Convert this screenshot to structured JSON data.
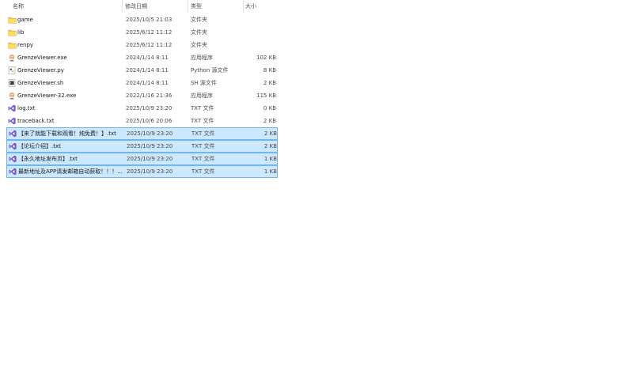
{
  "columns": {
    "name": "名称",
    "date": "修改日期",
    "type": "类型",
    "size": "大小"
  },
  "sort_indicator": "^",
  "files": [
    {
      "name": "game",
      "date": "2025/10/5 21:03",
      "type": "文件夹",
      "size": "",
      "icon": "folder-icon",
      "selected": false
    },
    {
      "name": "lib",
      "date": "2025/6/12 11:12",
      "type": "文件夹",
      "size": "",
      "icon": "folder-icon",
      "selected": false
    },
    {
      "name": "renpy",
      "date": "2025/6/12 11:12",
      "type": "文件夹",
      "size": "",
      "icon": "folder-icon",
      "selected": false
    },
    {
      "name": "GrenzeViewer.exe",
      "date": "2024/1/14 8:11",
      "type": "应用程序",
      "size": "102 KB",
      "icon": "app-icon",
      "selected": false
    },
    {
      "name": "GrenzeViewer.py",
      "date": "2024/1/14 8:11",
      "type": "Python 源文件",
      "size": "8 KB",
      "icon": "python-file-icon",
      "selected": false
    },
    {
      "name": "GrenzeViewer.sh",
      "date": "2024/1/14 8:11",
      "type": "SH 源文件",
      "size": "2 KB",
      "icon": "shell-file-icon",
      "selected": false
    },
    {
      "name": "GrenzeViewer-32.exe",
      "date": "2022/1/16 21:36",
      "type": "应用程序",
      "size": "115 KB",
      "icon": "app-icon",
      "selected": false
    },
    {
      "name": "log.txt",
      "date": "2025/10/9 23:20",
      "type": "TXT 文件",
      "size": "0 KB",
      "icon": "visual-studio-icon",
      "selected": false
    },
    {
      "name": "traceback.txt",
      "date": "2025/10/6 20:06",
      "type": "TXT 文件",
      "size": "2 KB",
      "icon": "visual-studio-icon",
      "selected": false
    },
    {
      "name": "【来了就能下载和观看！纯免费！】.txt",
      "date": "2025/10/9 23:20",
      "type": "TXT 文件",
      "size": "2 KB",
      "icon": "visual-studio-icon",
      "selected": true
    },
    {
      "name": "【论坛介绍】.txt",
      "date": "2025/10/9 23:20",
      "type": "TXT 文件",
      "size": "2 KB",
      "icon": "visual-studio-icon",
      "selected": true
    },
    {
      "name": "【永久地址发布页】.txt",
      "date": "2025/10/9 23:20",
      "type": "TXT 文件",
      "size": "1 KB",
      "icon": "visual-studio-icon",
      "selected": true
    },
    {
      "name": "最新地址及APP请发邮箱自动获取！！！...",
      "date": "2025/10/9 23:20",
      "type": "TXT 文件",
      "size": "1 KB",
      "icon": "visual-studio-icon",
      "selected": true
    }
  ],
  "colors": {
    "selection_bg": "#cce8ff",
    "selection_border": "#6fb6f0",
    "folder": "#f8c83e",
    "vs_purple": "#7b58c9"
  }
}
